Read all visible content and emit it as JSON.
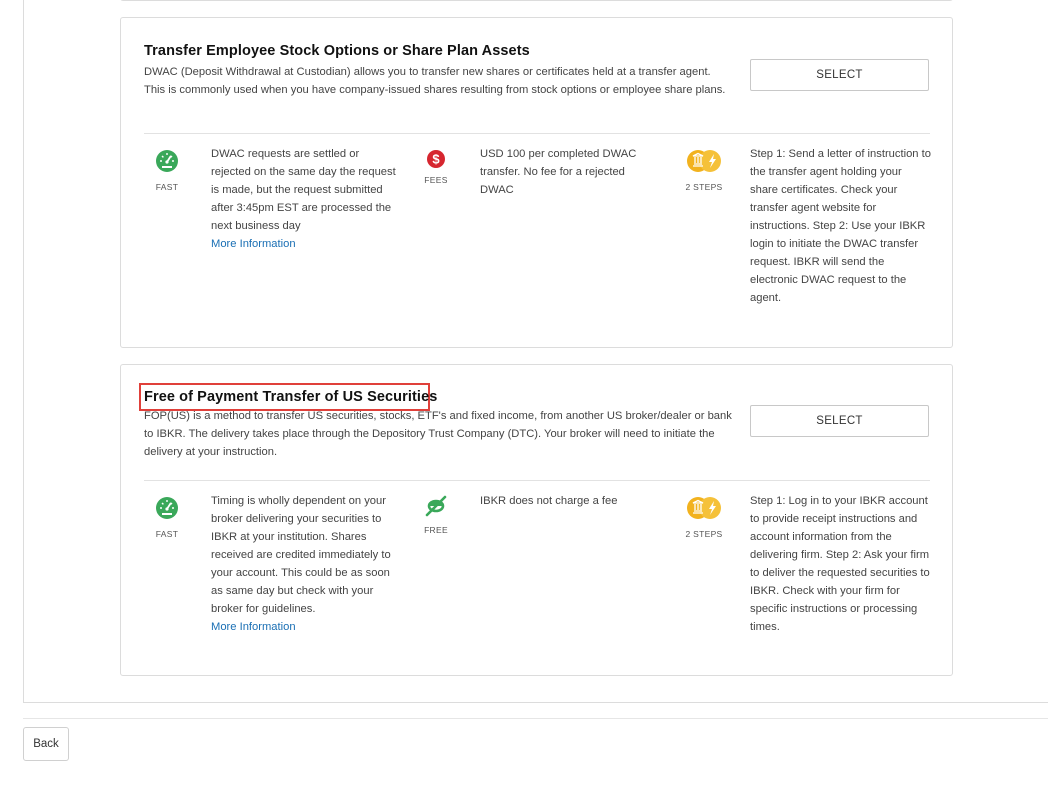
{
  "cards": [
    {
      "title": "Transfer Employee Stock Options or Share Plan Assets",
      "description": "DWAC (Deposit Withdrawal at Custodian) allows you to transfer new shares or certificates held at a transfer agent. This is commonly used when you have company-issued shares resulting from stock options or employee share plans.",
      "select_label": "SELECT",
      "speed": {
        "icon": "speedometer-icon",
        "label": "FAST",
        "text": "DWAC requests are settled or rejected on the same day the request is made, but the request submitted after 3:45pm EST are processed the next business day",
        "link": "More Information"
      },
      "cost": {
        "icon": "dollar-circle-icon",
        "label": "FEES",
        "text": "USD 100 per completed DWAC transfer. No fee for a rejected DWAC"
      },
      "steps": {
        "icon": "two-steps-icon",
        "label": "2 STEPS",
        "text": "Step 1: Send a letter of instruction to the transfer agent holding your share certificates. Check your transfer agent website for instructions. Step 2: Use your IBKR login to initiate the DWAC transfer request. IBKR will send the electronic DWAC request to the agent."
      }
    },
    {
      "title": "Free of Payment Transfer of US Securities",
      "description": "FOP(US) is a method to transfer US securities, stocks, ETF's and fixed income, from another US broker/dealer or bank to IBKR. The delivery takes place through the Depository Trust Company (DTC). Your broker will need to initiate the delivery at your instruction.",
      "select_label": "SELECT",
      "speed": {
        "icon": "speedometer-icon",
        "label": "FAST",
        "text": "Timing is wholly dependent on your broker delivering your securities to IBKR at your institution. Shares received are credited immediately to your account. This could be as soon as same day but check with your broker for guidelines.",
        "link": "More Information"
      },
      "cost": {
        "icon": "no-fee-icon",
        "label": "FREE",
        "text": "IBKR does not charge a fee"
      },
      "steps": {
        "icon": "two-steps-icon",
        "label": "2 STEPS",
        "text": "Step 1: Log in to your IBKR account to provide receipt instructions and account information from the delivering firm. Step 2: Ask your firm to deliver the requested securities to IBKR. Check with your firm for specific instructions or processing times."
      }
    }
  ],
  "footer": {
    "back_label": "Back"
  },
  "colors": {
    "green": "#3aa85a",
    "red": "#d6262f",
    "gold": "#f2b21e",
    "link": "#1a6fb4",
    "highlight": "#e0403a"
  }
}
